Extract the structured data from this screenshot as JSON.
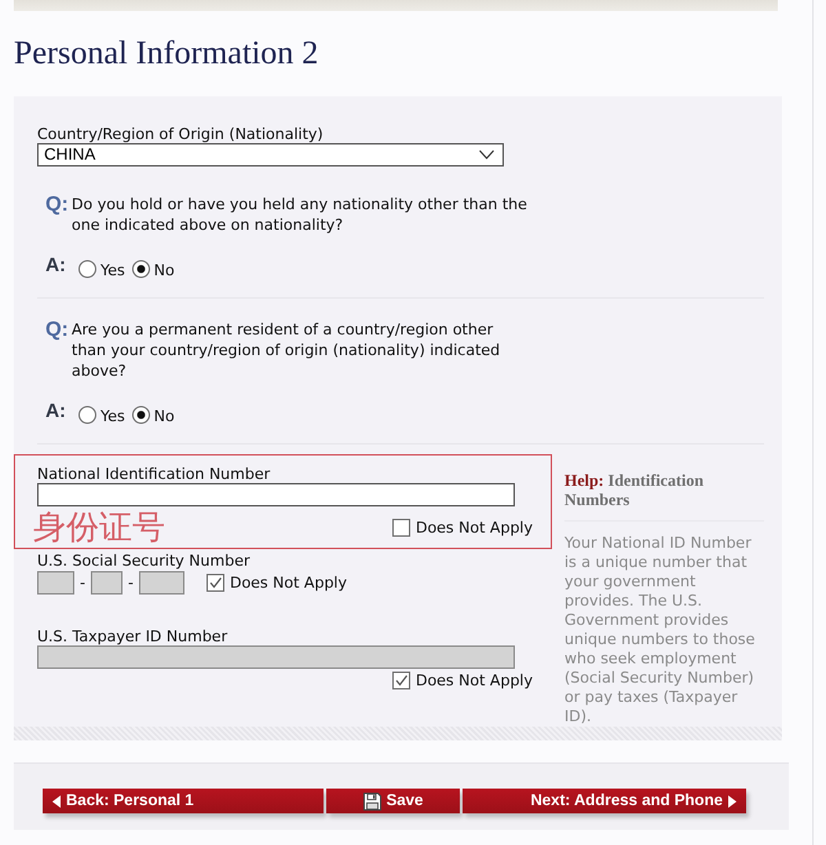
{
  "page": {
    "title": "Personal Information 2"
  },
  "nationality": {
    "label": "Country/Region of Origin (Nationality)",
    "value": "CHINA"
  },
  "questions": [
    {
      "q_marker": "Q:",
      "text": "Do you hold or have you held any nationality other than the one indicated above on nationality?",
      "a_marker": "A:",
      "options": [
        {
          "label": "Yes",
          "selected": false
        },
        {
          "label": "No",
          "selected": true
        }
      ]
    },
    {
      "q_marker": "Q:",
      "text": "Are you a permanent resident of a country/region other than your country/region of origin (nationality) indicated above?",
      "a_marker": "A:",
      "options": [
        {
          "label": "Yes",
          "selected": false
        },
        {
          "label": "No",
          "selected": true
        }
      ]
    }
  ],
  "id_fields": [
    {
      "kind": "single",
      "label": "National Identification Number",
      "disabled": false,
      "does_not_apply": {
        "label": "Does Not Apply",
        "checked": false
      },
      "note": "身份证号"
    },
    {
      "kind": "ssn",
      "label": "U.S. Social Security Number",
      "segments": [
        {
          "disabled": true
        },
        {
          "disabled": true
        },
        {
          "disabled": true
        }
      ],
      "separators": [
        "-",
        "-"
      ],
      "does_not_apply": {
        "label": "Does Not Apply",
        "checked": true
      }
    },
    {
      "kind": "single",
      "label": "U.S. Taxpayer ID Number",
      "disabled": true,
      "does_not_apply": {
        "label": "Does Not Apply",
        "checked": true
      }
    }
  ],
  "help": {
    "label": "Help:",
    "title": "Identification Numbers",
    "body": "Your National ID Number is a unique number that your government provides. The U.S. Government provides unique numbers to those who seek employment (Social Security Number) or pay taxes (Taxpayer ID)."
  },
  "buttons": [
    {
      "kind": "back",
      "label": "Back: Personal 1"
    },
    {
      "kind": "save",
      "label": "Save"
    },
    {
      "kind": "next",
      "label": "Next: Address and Phone"
    }
  ]
}
